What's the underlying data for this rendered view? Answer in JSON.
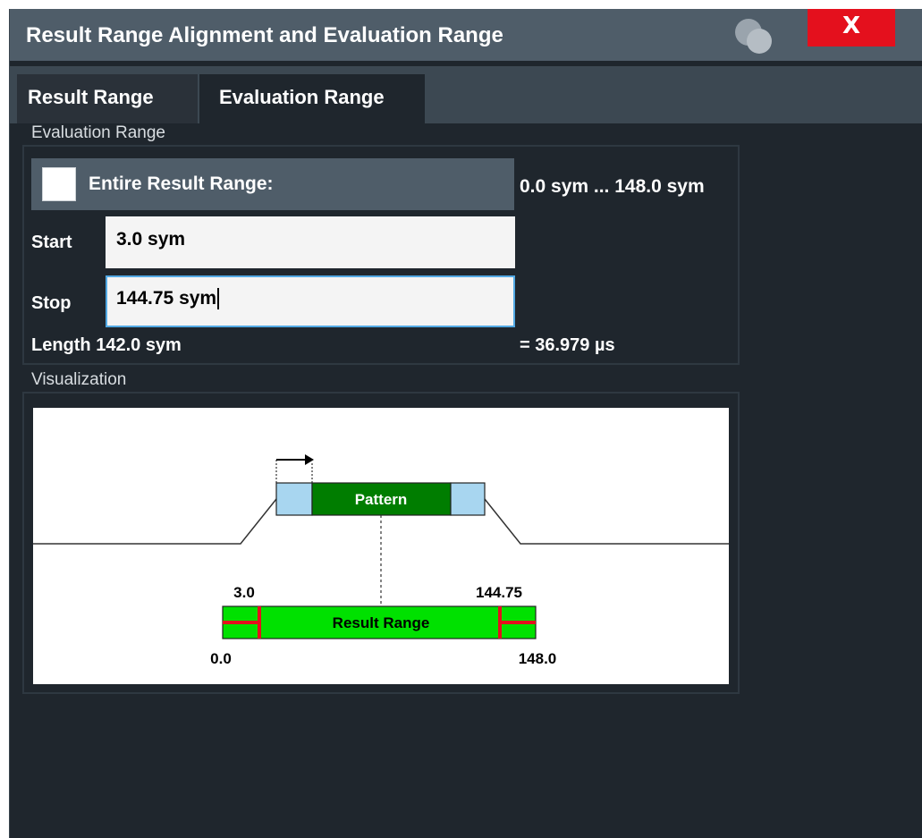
{
  "dialog": {
    "title": "Result Range Alignment and Evaluation Range",
    "close_label": "X"
  },
  "tabs": [
    {
      "label": "Result Range",
      "active": false
    },
    {
      "label": "Evaluation Range",
      "active": true
    }
  ],
  "evaluation_range": {
    "group_label": "Evaluation Range",
    "entire_label": "Entire Result Range:",
    "entire_checked": false,
    "range_text": "0.0 sym ... 148.0 sym",
    "start_label": "Start",
    "start_value": "3.0 sym",
    "stop_label": "Stop",
    "stop_value": "144.75 sym",
    "length_text": "Length 142.0 sym",
    "duration_text": "= 36.979 µs"
  },
  "visualization": {
    "group_label": "Visualization",
    "pattern_label": "Pattern",
    "result_range_label": "Result Range",
    "start_marker": "3.0",
    "stop_marker": "144.75",
    "range_min": "0.0",
    "range_max": "148.0"
  },
  "colors": {
    "title_bar": "#4f5d69",
    "close_button": "#e4101d",
    "pattern_green": "#007d00",
    "pattern_edge": "#a8d6f0",
    "result_range_green": "#00e100",
    "marker_red": "#e4101d",
    "focus_border": "#52a9e4"
  }
}
